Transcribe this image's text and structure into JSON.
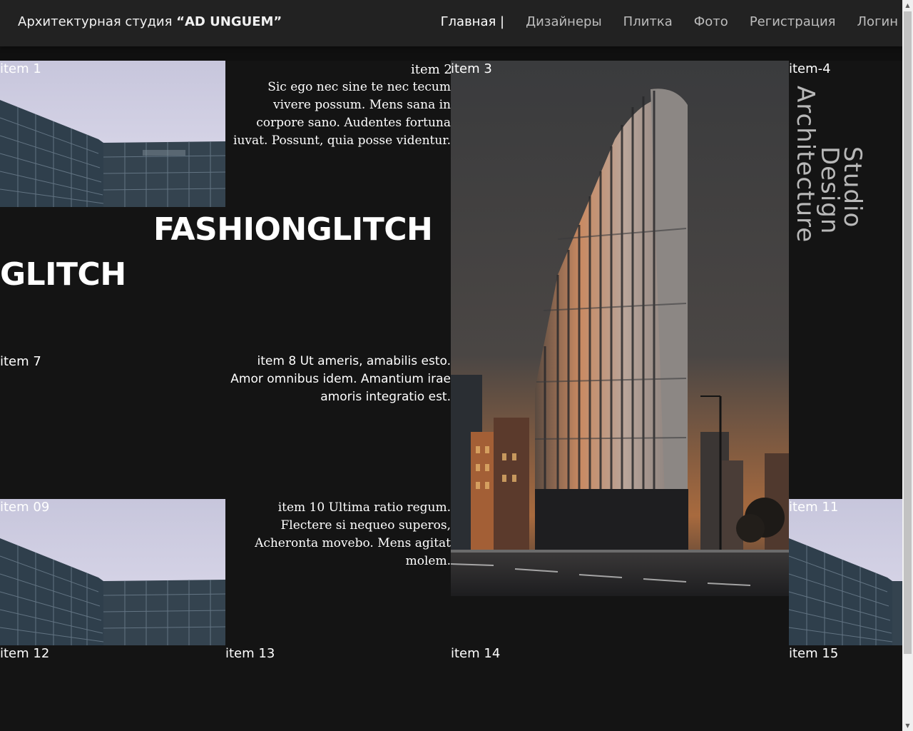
{
  "header": {
    "brand_prefix": "Архитектурная студия ",
    "brand_name": "“AD UNGUEM”",
    "nav": [
      {
        "label": "Главная |",
        "active": true
      },
      {
        "label": "Дизайнеры"
      },
      {
        "label": "Плитка"
      },
      {
        "label": "Фото"
      },
      {
        "label": "Регистрация"
      },
      {
        "label": "Логин"
      }
    ]
  },
  "items": {
    "item1": "item 1",
    "item2": "item 2",
    "item2_text": "Sic ego nec sine te nec tecum vivere possum. Mens sana in corpore sano. Audentes fortuna iuvat. Possunt, quia posse videntur.",
    "item3": "item 3",
    "item4": "item-4",
    "vertical": [
      "Studio",
      "Design",
      "Architecture"
    ],
    "fashion": "FASHIONGLITCH",
    "glitch": "GLITCH",
    "item7": "item 7",
    "item8_text": "item 8 Ut ameris, amabilis esto. Amor omnibus idem. Amantium irae amoris integratio est.",
    "item09": "item 09",
    "item10_text": "item 10 Ultima ratio regum. Flectere si nequeo superos, Acheronta movebo. Mens agitat molem.",
    "item11": "item 11",
    "item12": "item 12",
    "item13": "item 13",
    "item14": "item 14",
    "item15": "item 15"
  },
  "colors": {
    "background": "#141414",
    "header": "#222222",
    "vertical_text": "#b8b8b8"
  }
}
